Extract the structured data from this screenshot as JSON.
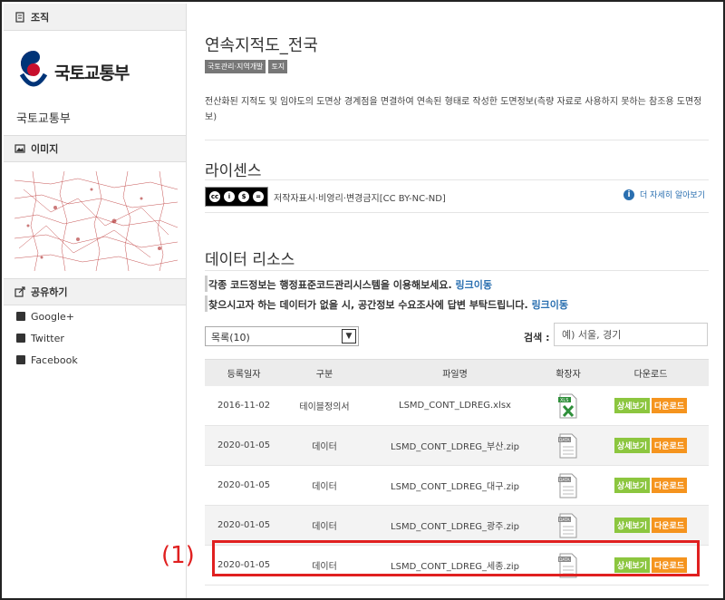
{
  "sidebar": {
    "org_header": "조직",
    "logo_text": "국토교통부",
    "org_name": "국토교통부",
    "image_header": "이미지",
    "share_header": "공유하기",
    "share_items": [
      {
        "label": "Google+",
        "icon": "google-plus-icon"
      },
      {
        "label": "Twitter",
        "icon": "twitter-icon"
      },
      {
        "label": "Facebook",
        "icon": "facebook-icon"
      }
    ]
  },
  "main": {
    "title": "연속지적도_전국",
    "tags": [
      "국토관리·지역개발",
      "토지"
    ],
    "description": "전산화된 지적도 및 임야도의 도면상 경계점을 면결하여 연속된 형태로 작성한 도면정보(측량 자료로 사용하지 못하는 참조용 도면정보)",
    "license_title": "라이센스",
    "license_text": "저작자표시·비영리·변경금지[CC BY-NC-ND]",
    "license_more": "더 자세히 알아보기",
    "resources_title": "데이터 리소스",
    "note1_text": "각종 코드정보는 행정표준코드관리시스템을 이용해보세요.",
    "note1_link": "링크이동",
    "note2_text": "찾으시고자 하는 데이터가 없을 시, 공간정보 수요조사에 답변 부탁드립니다.",
    "note2_link": "링크이동",
    "list_select": "목록(10)",
    "search_label": "검색 :",
    "search_placeholder": "예) 서울, 경기"
  },
  "table": {
    "headers": [
      "등록일자",
      "구분",
      "파일명",
      "확장자",
      "다운로드"
    ],
    "detail_label": "상세보기",
    "download_label": "다운로드",
    "rows": [
      {
        "date": "2016-11-02",
        "type": "테이블정의서",
        "file": "LSMD_CONT_LDREG.xlsx",
        "ext_icon": "xlsx-file-icon"
      },
      {
        "date": "2020-01-05",
        "type": "데이터",
        "file": "LSMD_CONT_LDREG_부산.zip",
        "ext_icon": "data-file-icon"
      },
      {
        "date": "2020-01-05",
        "type": "데이터",
        "file": "LSMD_CONT_LDREG_대구.zip",
        "ext_icon": "data-file-icon"
      },
      {
        "date": "2020-01-05",
        "type": "데이터",
        "file": "LSMD_CONT_LDREG_광주.zip",
        "ext_icon": "data-file-icon"
      },
      {
        "date": "2020-01-05",
        "type": "데이터",
        "file": "LSMD_CONT_LDREG_세종.zip",
        "ext_icon": "data-file-icon"
      }
    ]
  },
  "annotation": {
    "label": "(1)",
    "color": "#e02020"
  }
}
